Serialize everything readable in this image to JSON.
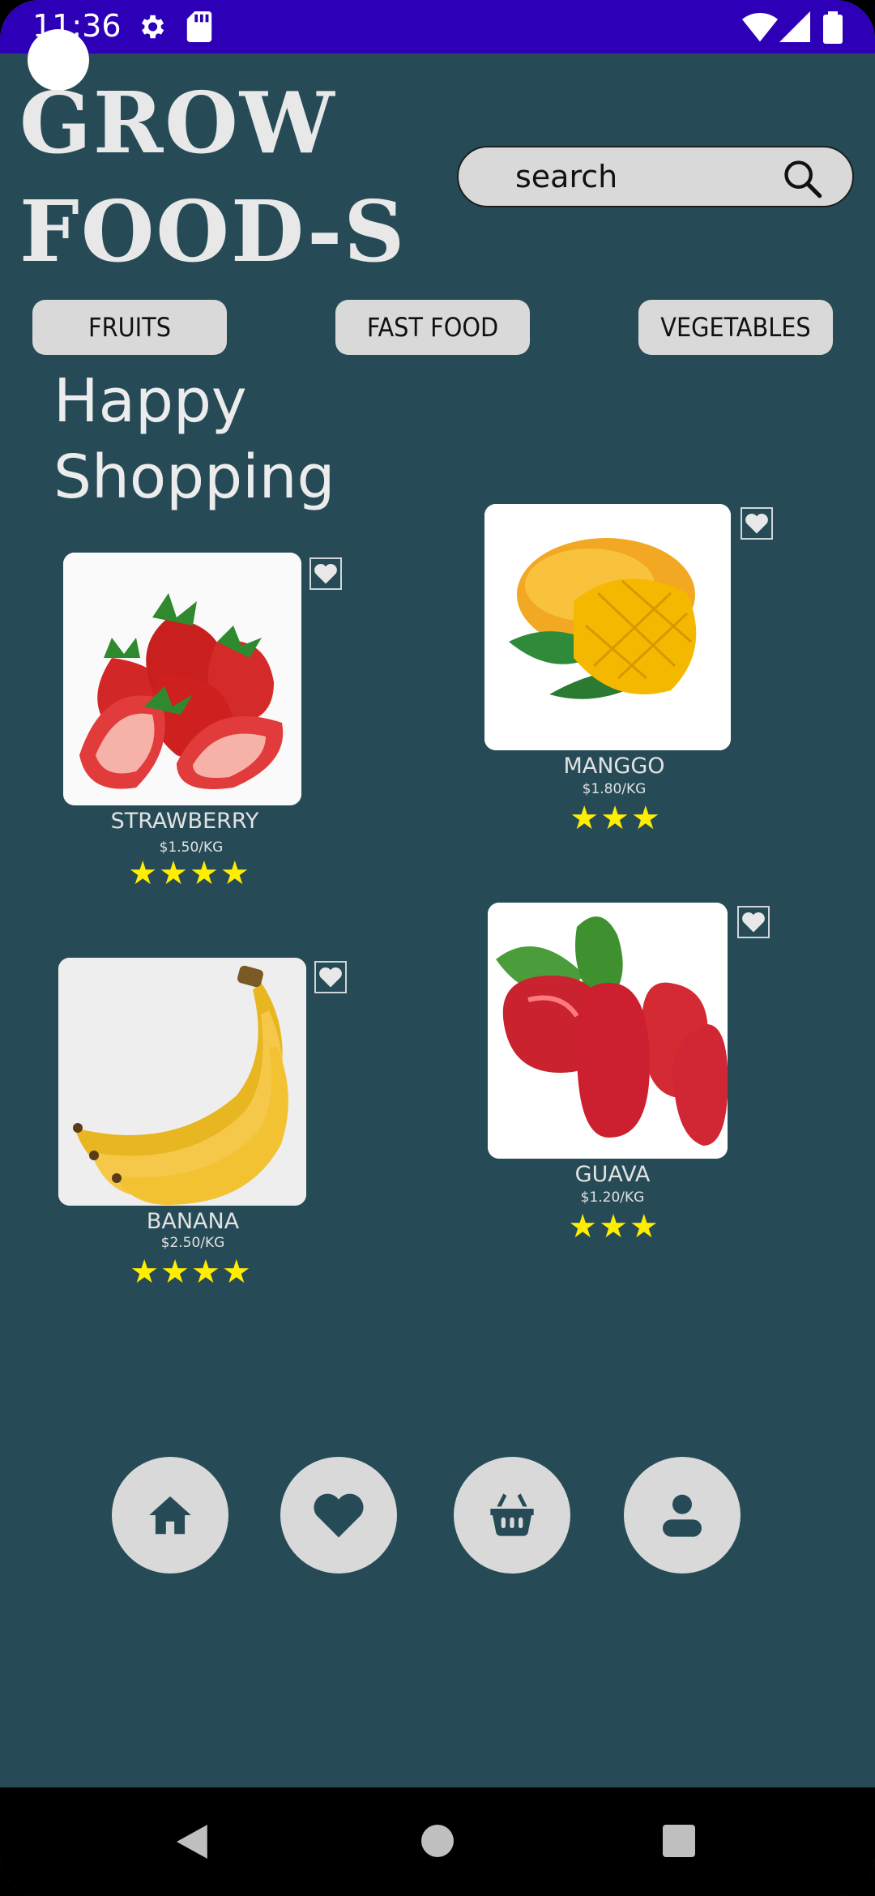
{
  "status_bar": {
    "time": "11:36"
  },
  "brand": {
    "line1": "GROW",
    "line2": "FOOD-S"
  },
  "search": {
    "placeholder": "search"
  },
  "categories": [
    "FRUITS",
    "FAST FOOD",
    "VEGETABLES"
  ],
  "greeting": {
    "line1": "Happy",
    "line2": "Shopping"
  },
  "products": [
    {
      "name": "STRAWBERRY",
      "price": "$1.50/KG",
      "rating": 4,
      "stars": "★★★★"
    },
    {
      "name": "MANGGO",
      "price": "$1.80/KG",
      "rating": 3,
      "stars": "★★★"
    },
    {
      "name": "BANANA",
      "price": "$2.50/KG",
      "rating": 4,
      "stars": "★★★★"
    },
    {
      "name": "GUAVA",
      "price": "$1.20/KG",
      "rating": 3,
      "stars": "★★★"
    }
  ],
  "bottom_nav": [
    "home-icon",
    "heart-icon",
    "basket-icon",
    "profile-icon"
  ],
  "colors": {
    "background": "#264b57",
    "status_bar": "#2d00b7",
    "pill": "#d9d9d9",
    "star": "#ffee00"
  }
}
